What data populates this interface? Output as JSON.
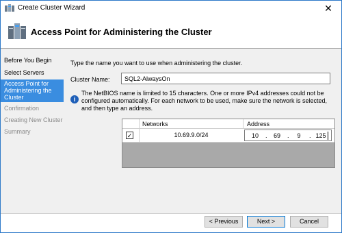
{
  "window": {
    "title": "Create Cluster Wizard",
    "close_glyph": "✕"
  },
  "header": {
    "title": "Access Point for Administering the Cluster",
    "icon": "cluster-servers-icon"
  },
  "nav": {
    "items": [
      {
        "label": "Before You Begin",
        "state": "normal"
      },
      {
        "label": "Select Servers",
        "state": "normal"
      },
      {
        "label": "Access Point for Administering the Cluster",
        "state": "active"
      },
      {
        "label": "Confirmation",
        "state": "disabled"
      },
      {
        "label": "Creating New Cluster",
        "state": "disabled"
      },
      {
        "label": "Summary",
        "state": "disabled"
      }
    ]
  },
  "main": {
    "instruction": "Type the name you want to use when administering the cluster.",
    "cluster_name_label": "Cluster Name:",
    "cluster_name_value": "SQL2-AlwaysOn",
    "info_text": "The NetBIOS name is limited to 15 characters.  One or more IPv4 addresses could not be configured automatically.  For each network to be used, make sure the network is selected, and then type an address.",
    "grid": {
      "columns": [
        "Networks",
        "Address"
      ],
      "rows": [
        {
          "checked": true,
          "network": "10.69.9.0/24",
          "address": [
            "10",
            "69",
            "9",
            "125"
          ]
        }
      ]
    }
  },
  "footer": {
    "previous": "< Previous",
    "next": "Next >",
    "cancel": "Cancel"
  },
  "colors": {
    "accent": "#3a8de0",
    "border": "#2b78c8",
    "grid_bg": "#a9a9a9"
  }
}
